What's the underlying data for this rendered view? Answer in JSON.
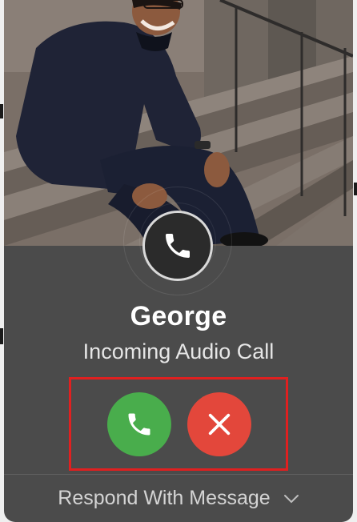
{
  "caller": {
    "name": "George",
    "call_type": "Incoming Audio Call"
  },
  "actions": {
    "accept_icon": "phone-icon",
    "decline_icon": "close-icon",
    "respond_label": "Respond With Message",
    "respond_icon": "chevron-down-icon"
  },
  "header_icon": "phone-icon",
  "colors": {
    "card_bg": "#4b4b4b",
    "accept": "#49ad4c",
    "decline": "#e3473b",
    "highlight_border": "#e02020"
  }
}
